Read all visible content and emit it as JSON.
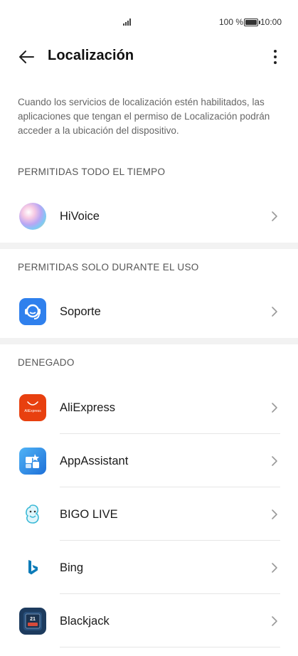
{
  "status_bar": {
    "battery_percent": "100 %",
    "time": "10:00"
  },
  "header": {
    "title": "Localización"
  },
  "description": "Cuando los servicios de localización estén habilitados, las aplicaciones que tengan el permiso de Localización podrán acceder a la ubicación del dispositivo.",
  "sections": {
    "always": {
      "label": "PERMITIDAS TODO EL TIEMPO",
      "apps": [
        {
          "name": "HiVoice",
          "icon": "hivoice-icon"
        }
      ]
    },
    "while_using": {
      "label": "PERMITIDAS SOLO DURANTE EL USO",
      "apps": [
        {
          "name": "Soporte",
          "icon": "support-icon"
        }
      ]
    },
    "denied": {
      "label": "DENEGADO",
      "apps": [
        {
          "name": "AliExpress",
          "icon": "aliexpress-icon",
          "icon_text": "AliExpress"
        },
        {
          "name": "AppAssistant",
          "icon": "appassistant-icon"
        },
        {
          "name": "BIGO LIVE",
          "icon": "bigo-live-icon"
        },
        {
          "name": "Bing",
          "icon": "bing-icon"
        },
        {
          "name": "Blackjack",
          "icon": "blackjack-icon",
          "icon_text": "21"
        }
      ]
    }
  },
  "colors": {
    "aliexpress": "#e8400f",
    "support": "#2f80ed",
    "appassistant": "#1e88e5",
    "bing": "#0c7bb8",
    "blackjack": "#1d3b5e",
    "band": "#f2f2f2"
  }
}
